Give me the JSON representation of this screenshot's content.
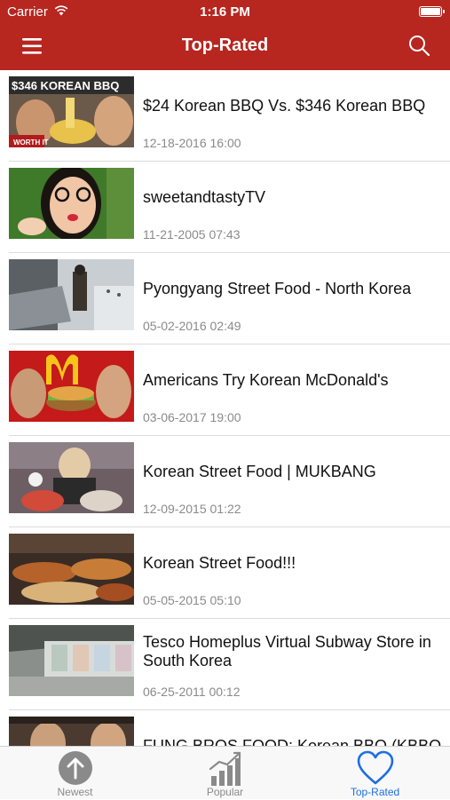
{
  "status_bar": {
    "carrier": "Carrier",
    "time": "1:16 PM"
  },
  "nav": {
    "title": "Top-Rated",
    "menu_icon": "hamburger-menu-icon",
    "search_icon": "search-icon"
  },
  "videos": [
    {
      "title": "$24 Korean BBQ Vs. $346 Korean BBQ",
      "date": "12-18-2016 16:00",
      "thumb_caption": "$346 KOREAN BBQ",
      "thumb_badge": "WORTH IT"
    },
    {
      "title": "sweetandtastyTV",
      "date": "11-21-2005 07:43"
    },
    {
      "title": "Pyongyang Street Food - North Korea",
      "date": "05-02-2016 02:49"
    },
    {
      "title": "Americans Try Korean McDonald's",
      "date": "03-06-2017 19:00"
    },
    {
      "title": "Korean Street Food  | MUKBANG",
      "date": "12-09-2015 01:22"
    },
    {
      "title": "Korean Street Food!!!",
      "date": "05-05-2015 05:10"
    },
    {
      "title": "Tesco Homeplus Virtual Subway Store in South Korea",
      "date": "06-25-2011 00:12"
    },
    {
      "title": "FUNG BROS FOOD: Korean BBQ (KBBQ",
      "date": ""
    }
  ],
  "tabs": [
    {
      "label": "Newest",
      "icon": "up-arrow-circle-icon"
    },
    {
      "label": "Popular",
      "icon": "bar-chart-trend-icon"
    },
    {
      "label": "Top-Rated",
      "icon": "heart-icon",
      "active": true
    }
  ],
  "colors": {
    "header": "#b7261f",
    "active_tab": "#1e6fe3",
    "inactive_tab": "#8a8a8a"
  }
}
